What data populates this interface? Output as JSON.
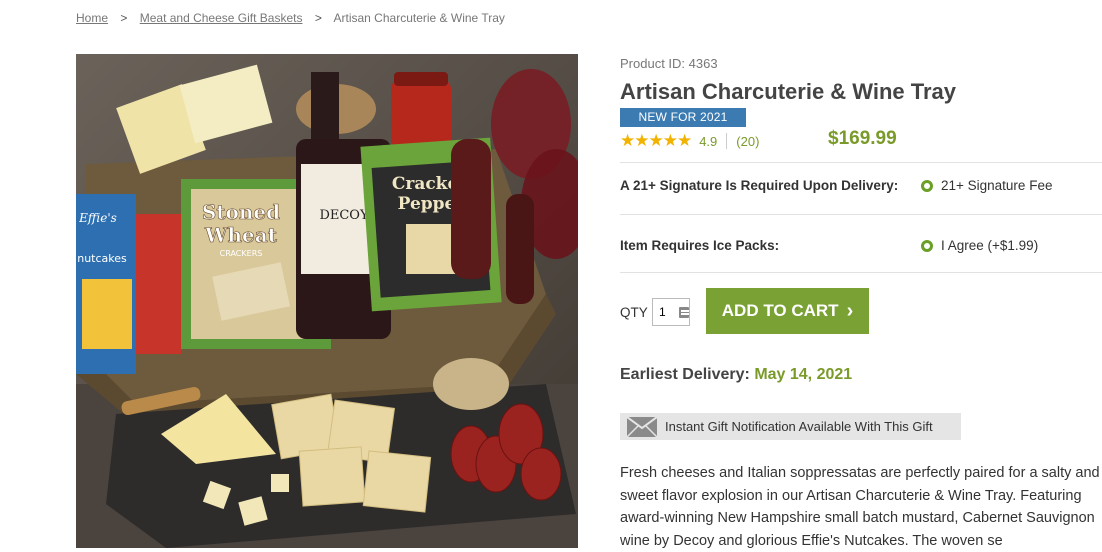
{
  "breadcrumb": {
    "home": "Home",
    "category": "Meat and Cheese Gift Baskets",
    "current": "Artisan Charcuterie & Wine Tray",
    "separator": ">"
  },
  "product": {
    "id_label": "Product ID: 4363",
    "title": "Artisan Charcuterie & Wine Tray",
    "badge": "NEW FOR 2021",
    "stars": "★★★★★",
    "rating": "4.9",
    "reviews": "(20)",
    "price": "$169.99"
  },
  "options": {
    "signature_label": "A 21+ Signature Is Required Upon Delivery:",
    "signature_value": "21+ Signature Fee",
    "icepacks_label": "Item Requires Ice Packs:",
    "icepacks_value": "I Agree (+$1.99)"
  },
  "cart": {
    "qty_label": "QTY",
    "qty_value": "1",
    "add_label": "ADD TO CART",
    "add_chevron": "›"
  },
  "delivery": {
    "label": "Earliest Delivery:",
    "date": "May 14, 2021"
  },
  "gift_notification": "Instant Gift Notification Available With This Gift",
  "description": "Fresh cheeses and Italian soppressatas are perfectly paired for a salty and sweet flavor explosion in our Artisan Charcuterie & Wine Tray. Featuring award-winning New Hampshire small batch mustard, Cabernet Sauvignon wine by Decoy and glorious Effie's Nutcakes. The woven se",
  "image_labels": {
    "crackers_1_line1": "Stoned",
    "crackers_1_line2": "Wheat",
    "crackers_1_line3": "CRACKERS",
    "wine": "DECOY",
    "crackers_2_line1": "Cracked",
    "crackers_2_line2": "Pepper",
    "effies": "Effie's",
    "nutcakes": "nutcakes"
  },
  "colors": {
    "accent_green": "#7aa134",
    "badge_blue": "#3b7bb2",
    "star": "#f2b300"
  }
}
